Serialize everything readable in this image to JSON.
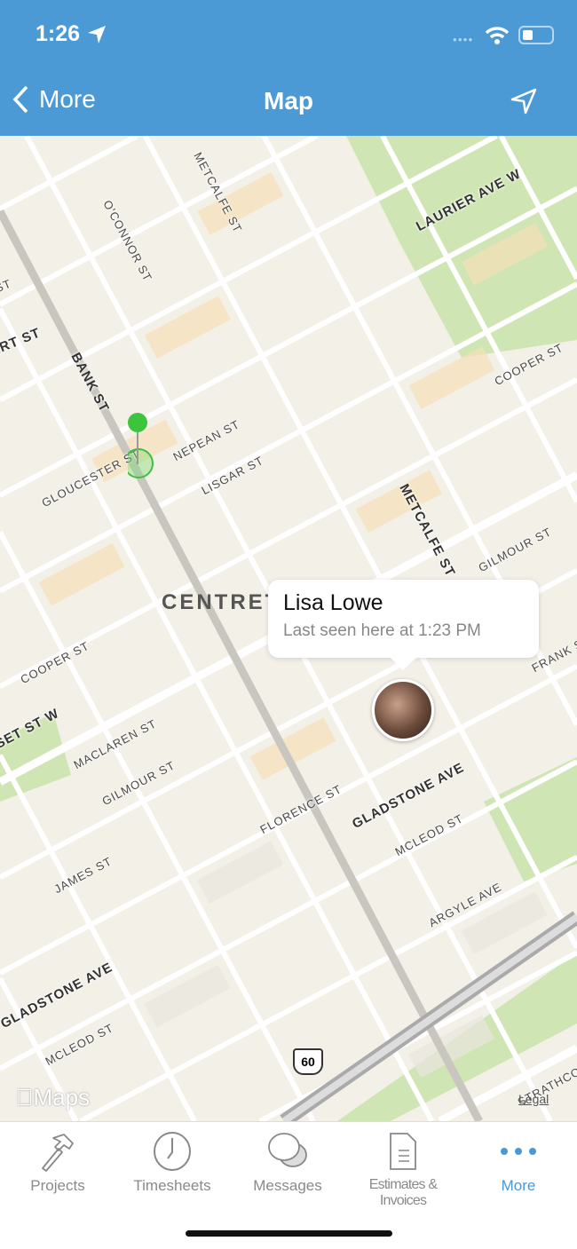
{
  "status_bar": {
    "time": "1:26"
  },
  "nav": {
    "back_label": "More",
    "title": "Map"
  },
  "map": {
    "district": "CENTRETOWN",
    "callout": {
      "name": "Lisa Lowe",
      "subtitle": "Last seen here at 1:23 PM"
    },
    "highway_shield": "60",
    "attribution": "Maps",
    "legal": "Legal",
    "streets": [
      "METCALFE ST",
      "O'CONNOR ST",
      "LAURIER AVE W",
      "ERT ST",
      "ST",
      "BANK ST",
      "COOPER ST",
      "GLOUCESTER ST",
      "NEPEAN ST",
      "LISGAR ST",
      "METCALFE ST",
      "GILMOUR ST",
      "COOPER ST",
      "FRANK S",
      "SET ST W",
      "MACLAREN ST",
      "GILMOUR ST",
      "FLORENCE ST",
      "GLADSTONE AVE",
      "MCLEOD ST",
      "JAMES ST",
      "ARGYLE AVE",
      "GLADSTONE AVE",
      "MCLEOD ST",
      "STRATHCON"
    ]
  },
  "tabs": [
    {
      "label": "Projects",
      "icon": "hammer-icon"
    },
    {
      "label": "Timesheets",
      "icon": "clock-icon"
    },
    {
      "label": "Messages",
      "icon": "chat-bubbles-icon"
    },
    {
      "label": "Estimates & Invoices",
      "icon": "document-icon"
    },
    {
      "label": "More",
      "icon": "more-dots-icon",
      "active": true
    }
  ],
  "colors": {
    "header": "#4b9ad6",
    "accent": "#4a98d5",
    "map_bg": "#f3f0e8",
    "park": "#cfe5b4",
    "building": "#f5dfb8"
  }
}
